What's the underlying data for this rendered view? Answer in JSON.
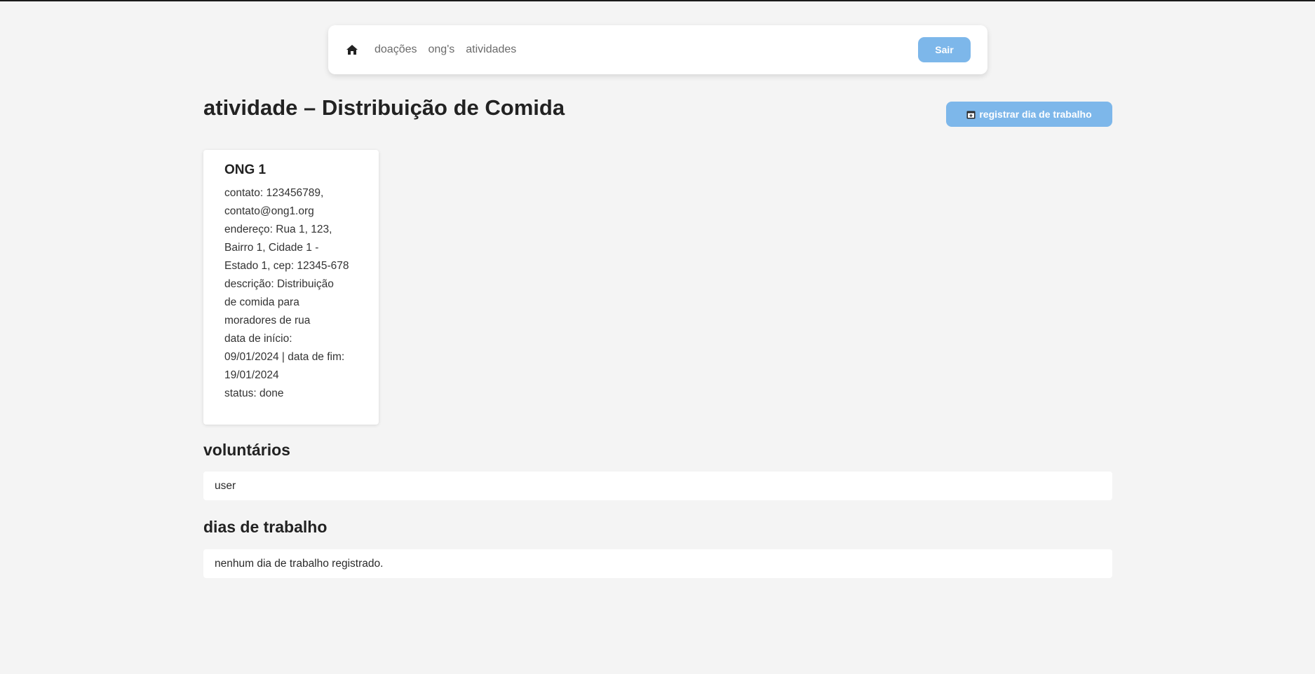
{
  "nav": {
    "links": [
      "doações",
      "ong's",
      "atividades"
    ],
    "logout_label": "Sair"
  },
  "page": {
    "title": "atividade – Distribuição de Comida",
    "register_button_label": "registrar dia de trabalho"
  },
  "ong": {
    "name": "ONG 1",
    "lines": [
      "contato: 123456789,",
      "contato@ong1.org",
      "endereço: Rua 1, 123,",
      "Bairro 1, Cidade 1 -",
      "Estado 1, cep: 12345-678",
      "descrição: Distribuição",
      "de comida para",
      "moradores de rua",
      "data de início:",
      "09/01/2024 | data de fim:",
      "19/01/2024",
      "status: done"
    ]
  },
  "volunteers": {
    "heading": "voluntários",
    "items": [
      "user"
    ]
  },
  "workdays": {
    "heading": "dias de trabalho",
    "empty_text": "nenhum dia de trabalho registrado."
  },
  "colors": {
    "accent": "#7db7ea",
    "background": "#f4f4f4"
  },
  "icons": {
    "home": "home-icon",
    "calendar": "calendar-plus-icon"
  }
}
